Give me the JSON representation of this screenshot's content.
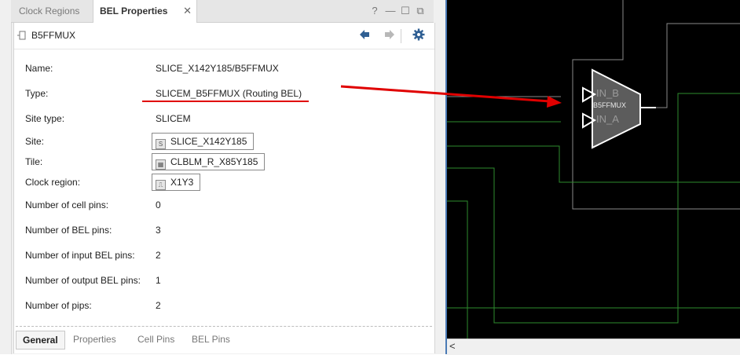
{
  "tabs": {
    "clock_regions": "Clock Regions",
    "bel_properties": "BEL Properties",
    "close": "✕"
  },
  "window_controls": {
    "help": "?",
    "minimize": "—",
    "maximize": "☐",
    "float": "⧉"
  },
  "header": {
    "title": "B5FFMUX",
    "back_icon": "back-arrow-icon",
    "forward_icon": "forward-arrow-icon",
    "settings_icon": "gear-icon"
  },
  "properties": [
    {
      "label": "Name:",
      "value": "SLICE_X142Y185/B5FFMUX"
    },
    {
      "label": "Type:",
      "value": "SLICEM_B5FFMUX (Routing BEL)"
    },
    {
      "label": "Site type:",
      "value": "SLICEM"
    },
    {
      "label": "Site:",
      "value": "SLICE_X142Y185",
      "icon": "S"
    },
    {
      "label": "Tile:",
      "value": "CLBLM_R_X85Y185",
      "icon": "▦"
    },
    {
      "label": "Clock region:",
      "value": "X1Y3",
      "icon": "⎍"
    },
    {
      "label": "Number of cell pins:",
      "value": "0"
    },
    {
      "label": "Number of BEL pins:",
      "value": "3"
    },
    {
      "label": "Number of input BEL pins:",
      "value": "2"
    },
    {
      "label": "Number of output BEL pins:",
      "value": "1"
    },
    {
      "label": "Number of pips:",
      "value": "2"
    }
  ],
  "bottom_tabs": [
    "General",
    "Properties",
    "Cell Pins",
    "BEL Pins"
  ],
  "device_view": {
    "mux_label": "B5FFMUX",
    "pin_b": "IN_B",
    "pin_a": "IN_A",
    "colors": {
      "background": "#000000",
      "wire": "#8a8a8a",
      "net": "#2e8b2e",
      "mux_fill": "#5c5c5c",
      "annotation": "#e00000"
    }
  },
  "scrollbar": {
    "left_arrow": "<"
  }
}
